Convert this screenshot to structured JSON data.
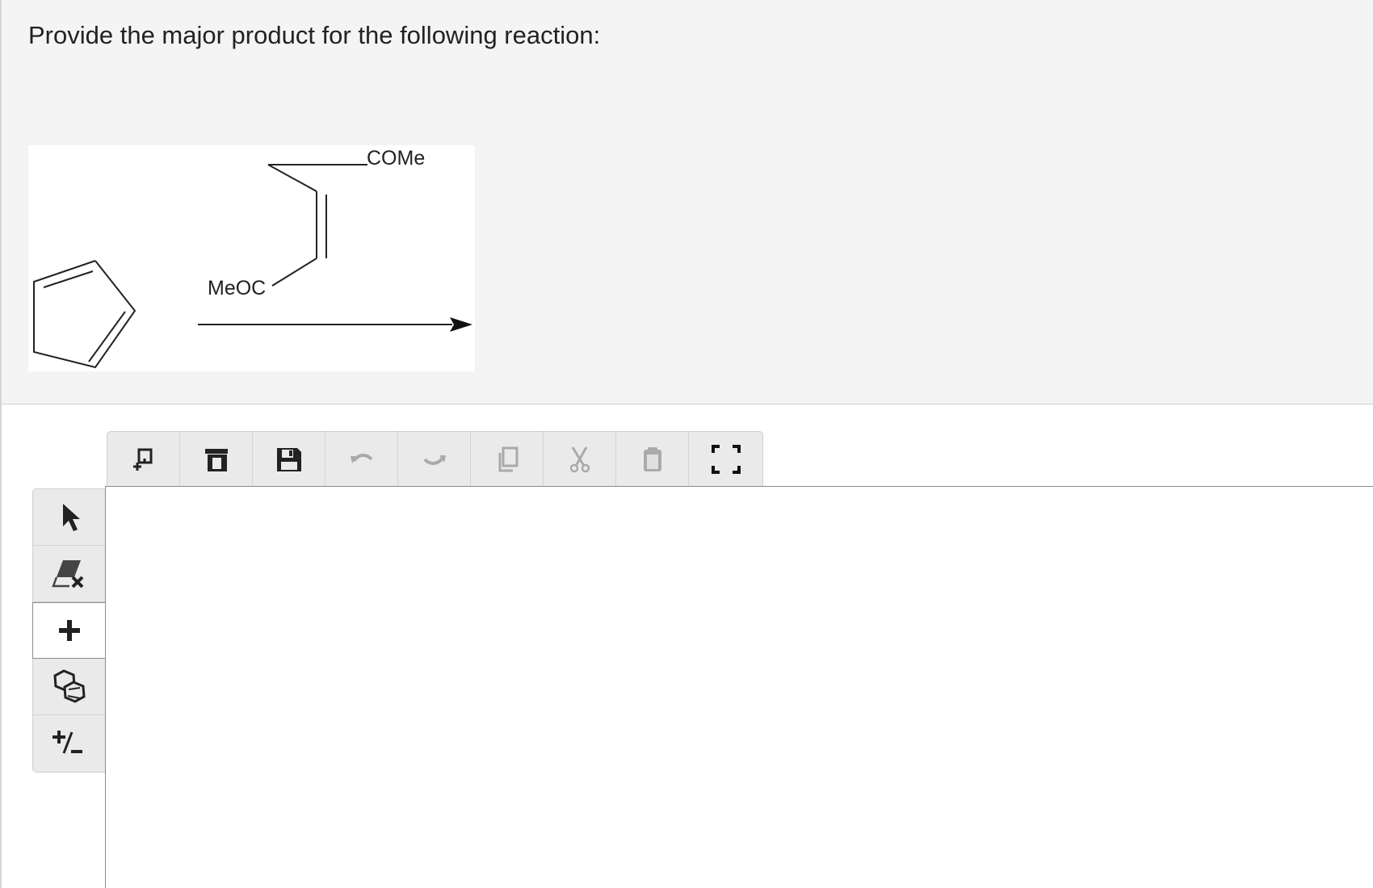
{
  "question": {
    "text": "Provide the major product for the following reaction:"
  },
  "reaction": {
    "reagent_top_label": "COMe",
    "reagent_left_label": "MeOC"
  },
  "top_toolbar": {
    "buttons": [
      {
        "name": "clear-canvas-icon",
        "enabled": true
      },
      {
        "name": "open-icon",
        "enabled": true
      },
      {
        "name": "save-icon",
        "enabled": true
      },
      {
        "name": "undo-icon",
        "enabled": false
      },
      {
        "name": "redo-icon",
        "enabled": false
      },
      {
        "name": "copy-icon",
        "enabled": false
      },
      {
        "name": "cut-icon",
        "enabled": false
      },
      {
        "name": "paste-icon",
        "enabled": false
      },
      {
        "name": "fullscreen-icon",
        "enabled": true
      }
    ]
  },
  "left_toolbar": {
    "tools": [
      {
        "name": "select-arrow-icon",
        "active": false
      },
      {
        "name": "eraser-icon",
        "active": false
      },
      {
        "name": "add-atom-icon",
        "active": true
      },
      {
        "name": "ring-templates-icon",
        "active": false
      },
      {
        "name": "charge-icon",
        "active": false
      }
    ]
  },
  "colors": {
    "question_background": "#f4f4f4",
    "toolbar_background": "#eaeaea",
    "icon_active": "#222222",
    "icon_disabled": "#aaaaaa",
    "canvas_border": "#8c8c8c"
  }
}
